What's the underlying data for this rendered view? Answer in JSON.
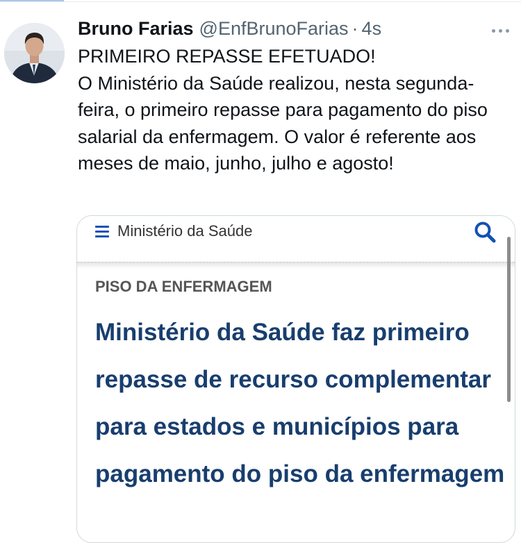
{
  "tweet": {
    "author_name": "Bruno Farias",
    "author_handle": "@EnfBrunoFarias",
    "separator": "·",
    "timestamp": "4s",
    "text_lines": [
      "PRIMEIRO REPASSE EFETUADO!",
      "O Ministério da Saúde realizou, nesta segunda-feira, o primeiro repasse para pagamento do piso salarial da enfermagem. O valor é referente aos meses de maio, junho, julho e agosto!"
    ]
  },
  "card": {
    "site_name": "Ministério da Saúde",
    "section_label": "PISO DA ENFERMAGEM",
    "headline": "Ministério da Saúde faz primeiro repasse de recurso complementar para estados e municípios para pagamento do piso da enfermagem"
  },
  "icons": {
    "menu": "hamburger-menu-icon",
    "search": "search-icon",
    "more": "more-options-icon"
  },
  "colors": {
    "text_primary": "#0f1419",
    "text_secondary": "#536471",
    "gov_blue": "#1351b4",
    "headline_blue": "#183e6e"
  }
}
